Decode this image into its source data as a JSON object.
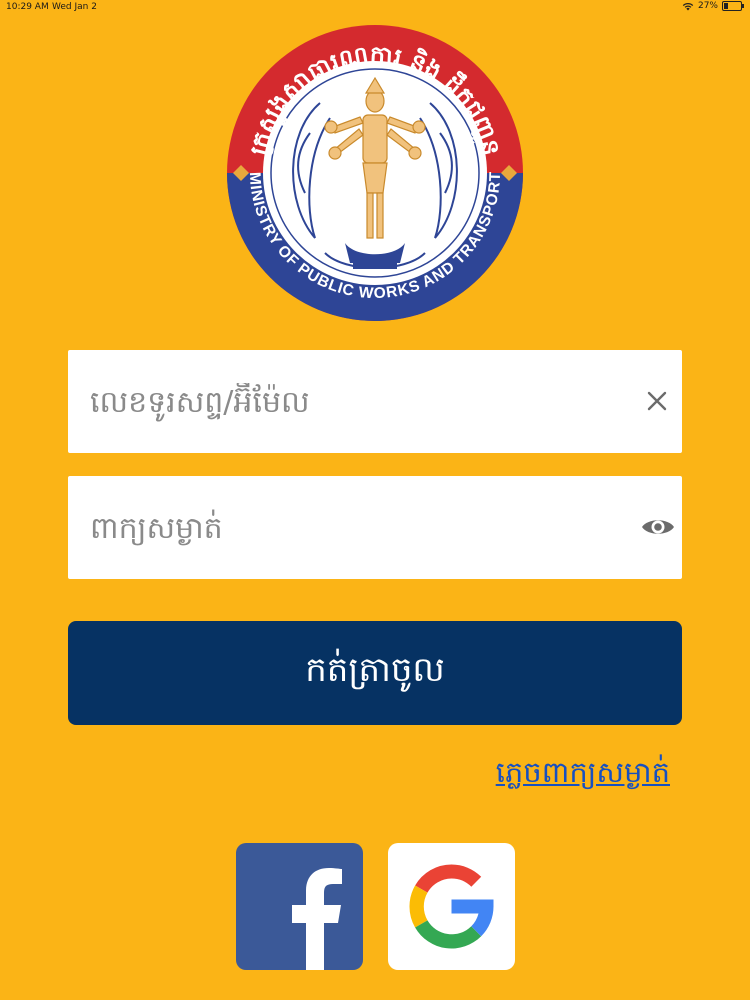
{
  "status_bar": {
    "time": "10:29 AM",
    "date": "Wed Jan 2",
    "battery": "27%",
    "battery_level": 0.27
  },
  "logo": {
    "alt": "Ministry of Public Works and Transport seal",
    "top_text_kh": "ក្រសួងសាធារណការ និង ដឹកជញ្ជូន",
    "bottom_text_en": "MINISTRY OF PUBLIC WORKS AND TRANSPORT",
    "colors": {
      "red": "#D42A2E",
      "blue": "#2E4596",
      "gold": "#E8A83C"
    }
  },
  "login_form": {
    "username_placeholder": "លេខទូរសព្ទ/អ៊ីម៉ែល",
    "username_value": "",
    "password_placeholder": "ពាក្យសម្ងាត់",
    "password_value": "",
    "submit_label": "កត់ត្រាចូល",
    "forgot_label": "ភ្លេចពាក្យសម្ងាត់"
  },
  "social": {
    "facebook_icon": "facebook-icon",
    "google_icon": "google-icon"
  },
  "colors": {
    "background": "#FBB416",
    "button": "#063263",
    "link": "#1750C0",
    "facebook": "#3B5998"
  }
}
